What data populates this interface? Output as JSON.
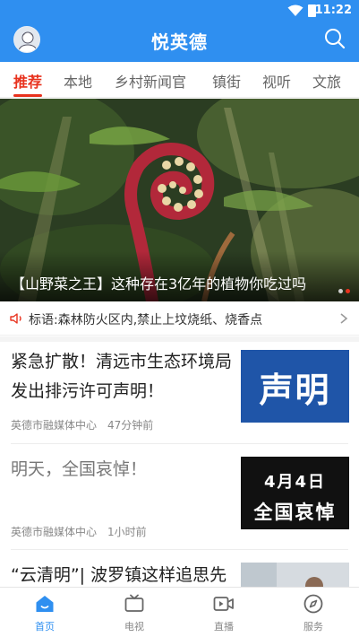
{
  "status_bar": {
    "time": "11:22",
    "icons": [
      "wifi-icon",
      "battery-icon"
    ]
  },
  "header": {
    "title": "悦英德",
    "avatar_icon": "avatar-icon",
    "search_icon": "search-icon"
  },
  "tabs": [
    "推荐",
    "本地",
    "乡村新闻官",
    "镇街",
    "视听",
    "文旅"
  ],
  "active_tab": "推荐",
  "hero": {
    "caption": "【山野菜之王】这种存在3亿年的植物你吃过吗",
    "slides": 2,
    "active_slide": 2
  },
  "notice": {
    "icon": "speaker-icon",
    "text": "标语:森林防火区内,禁止上坟烧纸、烧香点"
  },
  "news": [
    {
      "title": "紧急扩散！清远市生态环境局发出排污许可声明！",
      "source": "英德市融媒体中心",
      "time": "47分钟前",
      "thumb_text": [
        "声明"
      ]
    },
    {
      "title": "明天，全国哀悼！",
      "source": "英德市融媒体中心",
      "time": "1小时前",
      "thumb_text": [
        "4月4日",
        "全国哀悼"
      ]
    },
    {
      "title": "“云清明”| 波罗镇这样追思先",
      "source": "",
      "time": ""
    }
  ],
  "bottom_nav": [
    {
      "label": "首页",
      "icon": "home-icon",
      "active": true
    },
    {
      "label": "电视",
      "icon": "tv-icon",
      "active": false
    },
    {
      "label": "直播",
      "icon": "live-video-icon",
      "active": false
    },
    {
      "label": "服务",
      "icon": "compass-icon",
      "active": false
    }
  ],
  "colors": {
    "brand_blue": "#2f8ff0",
    "accent_red": "#e8321e",
    "thumb_blue": "#1f55a8"
  }
}
